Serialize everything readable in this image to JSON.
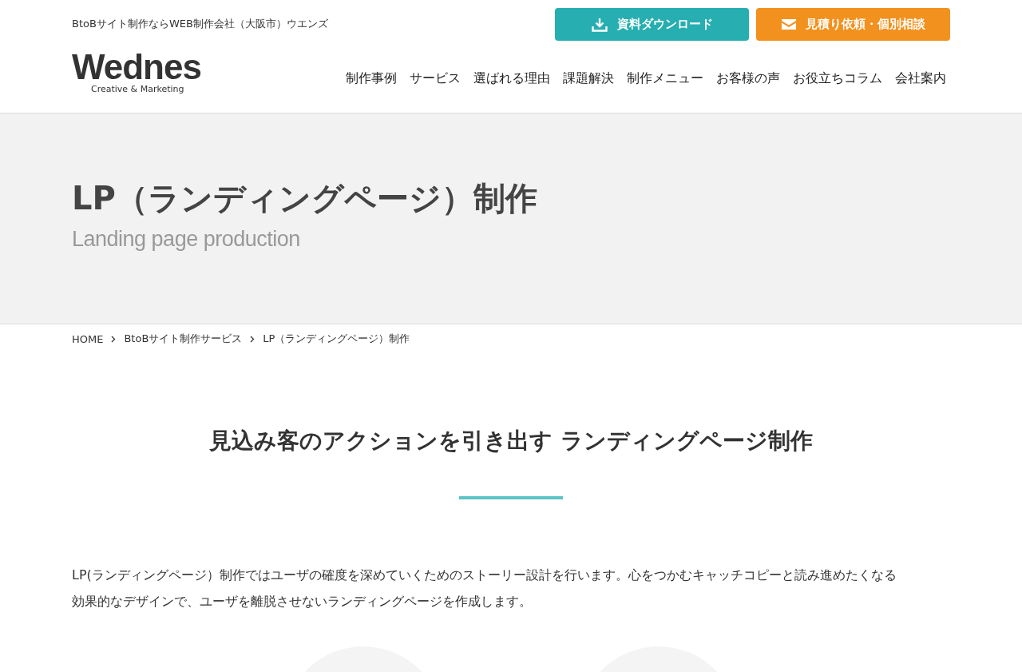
{
  "header": {
    "tagline": "BtoBサイト制作ならWEB制作会社（大阪市）ウエンズ",
    "logo": {
      "wordmark": "Wednes",
      "subtitle": "Creative & Marketing"
    },
    "buttons": [
      {
        "label": "資料ダウンロード",
        "kind": "download"
      },
      {
        "label": "見積り依頼・個別相談",
        "kind": "mail"
      }
    ],
    "nav": [
      "制作事例",
      "サービス",
      "選ばれる理由",
      "課題解決",
      "制作メニュー",
      "お客様の声",
      "お役立ちコラム",
      "会社案内"
    ]
  },
  "hero": {
    "title": "LP（ランディングページ）制作",
    "subtitle": "Landing page production"
  },
  "breadcrumb": [
    "HOME",
    "BtoBサイト制作サービス",
    "LP（ランディングページ）制作"
  ],
  "section": {
    "heading": "見込み客のアクションを引き出す ランディングページ制作",
    "paragraph_lines": [
      "LP(ランディングページ）制作ではユーザの確度を深めていくためのストーリー設計を行います。心をつかむキャッチコピーと読み進めたくなる",
      "効果的なデザインで、ユーザを離脱させないランディングページを作成します。"
    ]
  }
}
